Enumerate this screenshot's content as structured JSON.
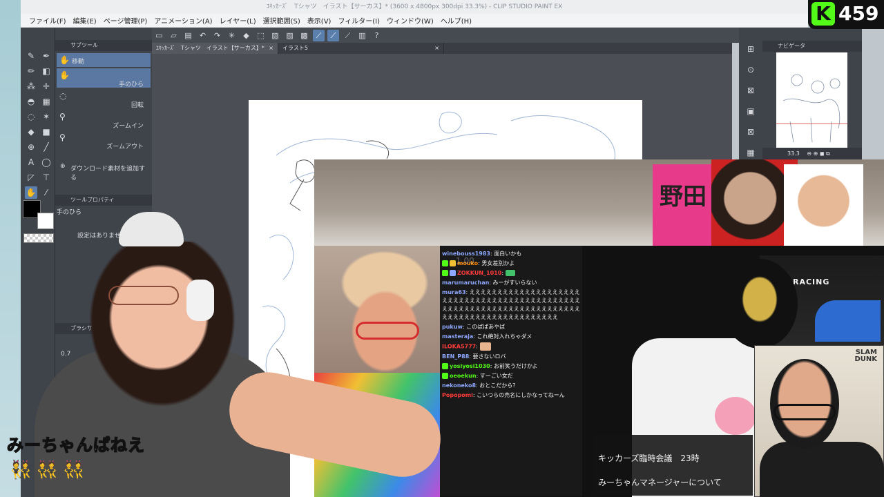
{
  "app": {
    "title": "ﾕｷｯｶｰｽﾞ　Tシャツ　イラスト【サーカス】* (3600 x 4800px 300dpi 33.3%)  - CLIP STUDIO PAINT EX",
    "menu": [
      "ファイル(F)",
      "編集(E)",
      "ページ管理(P)",
      "アニメーション(A)",
      "レイヤー(L)",
      "選択範囲(S)",
      "表示(V)",
      "フィルター(I)",
      "ウィンドウ(W)",
      "ヘルプ(H)"
    ],
    "tabs": [
      "ﾕｷｯｶｰｽﾞ　Tシャツ　イラスト【サーカス】*",
      "イラスト5"
    ],
    "subtool": {
      "header": "サブツール",
      "items": [
        {
          "label": "移動",
          "icon": "hand-icon"
        },
        {
          "label": "手のひら",
          "icon": "hand-icon"
        },
        {
          "label": "回転",
          "icon": "rotate-icon"
        },
        {
          "label": "ズームイン",
          "icon": "zoom-in-icon"
        },
        {
          "label": "ズームアウト",
          "icon": "zoom-out-icon"
        }
      ],
      "add_material": "ダウンロード素材を追加する"
    },
    "tool_property": {
      "header": "ツールプロパティ",
      "tool_name": "手のひら",
      "empty_text": "設定はありません"
    },
    "brush_size": {
      "header": "ブラシサ",
      "value": "0.7"
    },
    "navigator": {
      "header": "ナビゲータ",
      "zoom": "33.3"
    }
  },
  "overlay": {
    "counter": {
      "letter": "K",
      "value": "459"
    },
    "banner_text": "野田",
    "chair_brand": "RACING",
    "poster_text": "SLAM DUNK",
    "faint_number": "1.00",
    "chat": [
      {
        "user": "winebouss1983",
        "message": "面白いかも",
        "color": "#8fa8ff"
      },
      {
        "user": "mouko",
        "message": "男女差別かよ",
        "color": "#ff8a00"
      },
      {
        "user": "ZOKKUN_1010",
        "message": "",
        "color": "#ff3b3b"
      },
      {
        "user": "marumaruchan",
        "message": "みーがすいらない",
        "color": "#8fa8ff"
      },
      {
        "user": "mura63",
        "message": "えええええええええええええええええええええええええええええええええええええええええええええええええええええええええええええええええええええええええええええええええええええええええええ",
        "color": "#8fa8ff"
      },
      {
        "user": "pukuw",
        "message": "このぱぱあやば",
        "color": "#8fa8ff"
      },
      {
        "user": "masteraja",
        "message": "これ絶対入れちゃダメ",
        "color": "#8fa8ff"
      },
      {
        "user": "ILOKA5777",
        "message": "",
        "color": "#ff3b3b"
      },
      {
        "user": "BEN_P88",
        "message": "要さないロバ",
        "color": "#8fa8ff"
      },
      {
        "user": "yosiyosi1030",
        "message": "お前笑うだけかよ",
        "color": "#53fc18"
      },
      {
        "user": "oeoekun",
        "message": "すーごい女だ",
        "color": "#53fc18"
      },
      {
        "user": "nekoneko8",
        "message": "おとこだから？",
        "color": "#8fa8ff"
      },
      {
        "user": "Popopomi",
        "message": "こいつらの売名にしかなってねーん",
        "color": "#ff3b3b"
      }
    ],
    "schedule": {
      "line1": "キッカーズ臨時会議　23時",
      "line2": "みーちゃんマネージャーについて"
    },
    "streamer_name": "みーちゃんぱねえ",
    "emotes": "👯👯👯"
  },
  "colors": {
    "accent": "#5c80ad",
    "kick_green": "#53fc18",
    "banner_pink": "#e83a8a"
  }
}
